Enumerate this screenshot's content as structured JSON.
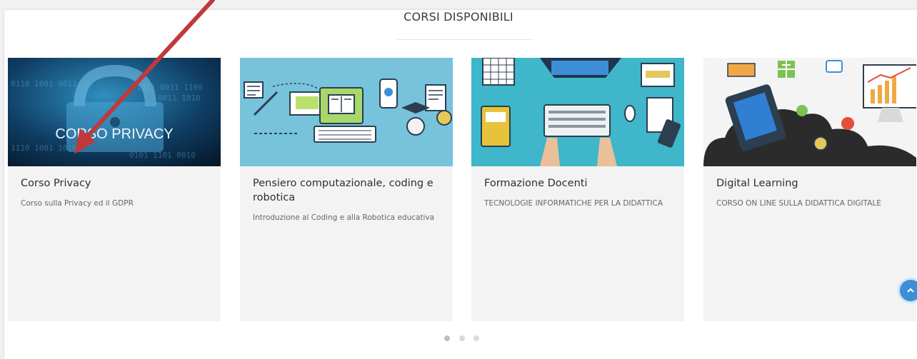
{
  "section": {
    "title": "CORSI DISPONIBILI"
  },
  "courses": [
    {
      "title": "Corso Privacy",
      "description": "Corso sulla Privacy ed il GDPR",
      "image_text": "CORSO PRIVACY",
      "image_icon": "padlock-icon"
    },
    {
      "title": "Pensiero computazionale, coding e robotica",
      "description": "Introduzione al Coding e alla Robotica educativa",
      "image_icon": "computer-coding-illustration"
    },
    {
      "title": "Formazione Docenti",
      "description": "TECNOLOGIE INFORMATICHE PER LA DIDATTICA",
      "image_icon": "desk-workstation-illustration"
    },
    {
      "title": "Digital Learning",
      "description": "CORSO ON LINE SULLA DIDATTICA DIGITALE",
      "image_icon": "tablet-cloud-illustration"
    }
  ],
  "carousel": {
    "pages": 3,
    "active": 0
  },
  "colors": {
    "accent": "#3c8fd6",
    "annotation_arrow": "#c0393b",
    "card_bg": "#f3f3f3"
  }
}
